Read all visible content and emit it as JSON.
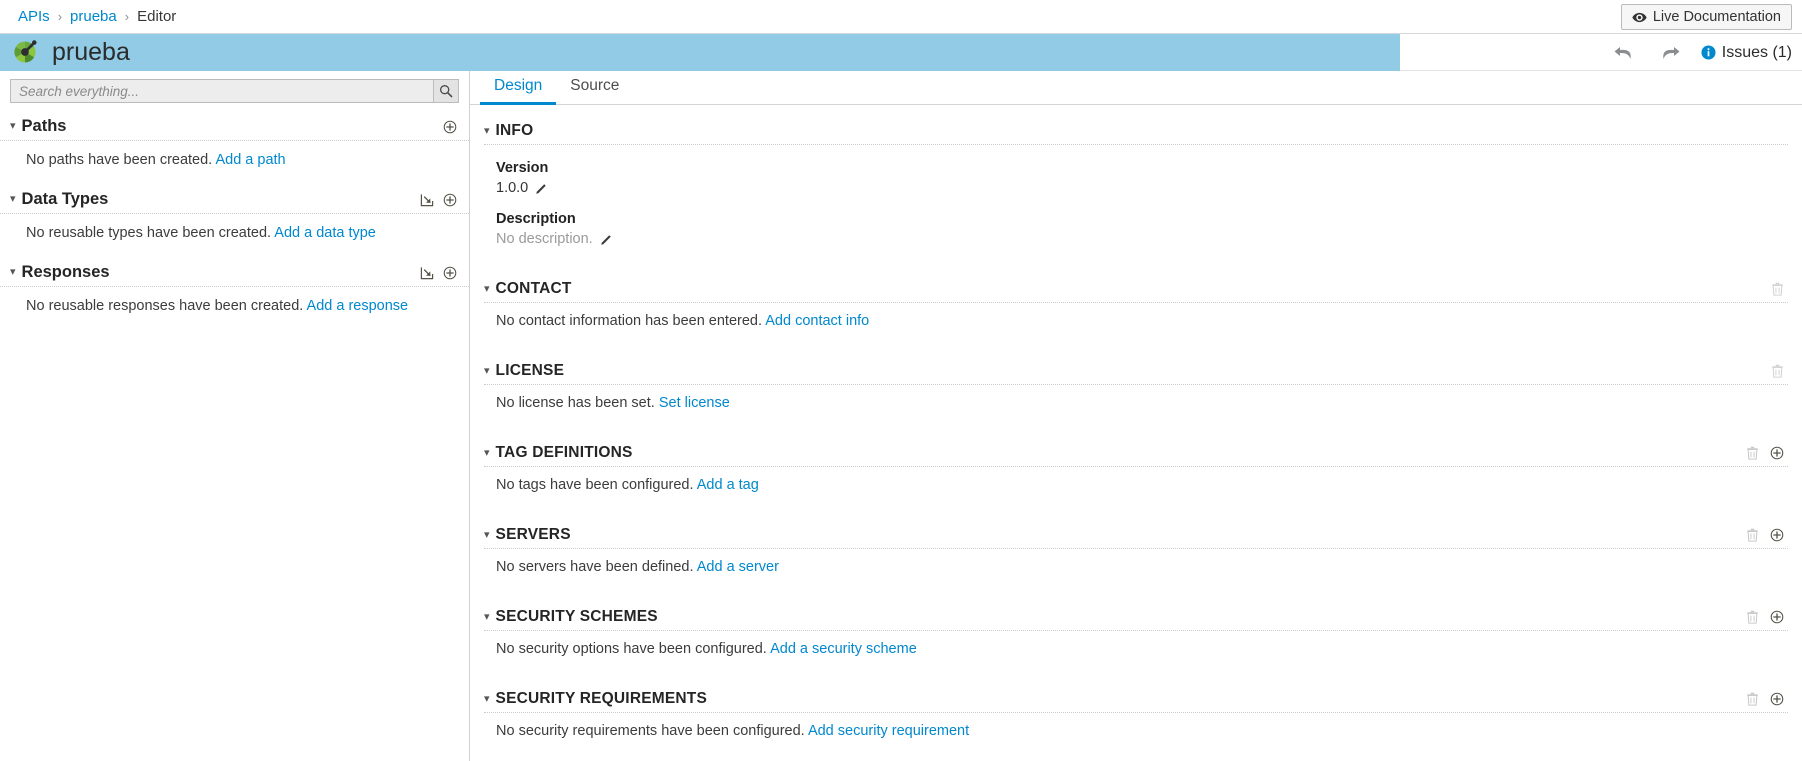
{
  "breadcrumb": {
    "items": [
      {
        "label": "APIs",
        "current": false
      },
      {
        "label": "prueba",
        "current": false
      },
      {
        "label": "Editor",
        "current": true
      }
    ],
    "separator": "›"
  },
  "topbar": {
    "live_documentation_label": "Live Documentation",
    "live_documentation_icon": "eye-icon"
  },
  "title_bar": {
    "api_name": "prueba",
    "logo_icon": "apicurio-logo-icon",
    "undo_icon": "undo-arrow-icon",
    "redo_icon": "redo-arrow-icon",
    "issues_label": "Issues (1)",
    "issues_icon": "info-circle-icon",
    "accent_color": "#91cbe5"
  },
  "sidebar": {
    "search": {
      "placeholder": "Search everything...",
      "value": "",
      "button_icon": "search-icon"
    },
    "sections": [
      {
        "title": "Paths",
        "caret_icon": "chevron-down-icon",
        "actions": [
          {
            "icon": "plus-circle-icon",
            "name": "add-path-icon"
          }
        ],
        "empty_text": "No paths have been created.",
        "empty_link": "Add a path"
      },
      {
        "title": "Data Types",
        "caret_icon": "chevron-down-icon",
        "actions": [
          {
            "icon": "import-icon",
            "name": "import-data-type-icon"
          },
          {
            "icon": "plus-circle-icon",
            "name": "add-data-type-icon"
          }
        ],
        "empty_text": "No reusable types have been created.",
        "empty_link": "Add a data type"
      },
      {
        "title": "Responses",
        "caret_icon": "chevron-down-icon",
        "actions": [
          {
            "icon": "import-icon",
            "name": "import-response-icon"
          },
          {
            "icon": "plus-circle-icon",
            "name": "add-response-icon"
          }
        ],
        "empty_text": "No reusable responses have been created.",
        "empty_link": "Add a response"
      }
    ]
  },
  "main": {
    "tabs": [
      {
        "label": "Design",
        "active": true
      },
      {
        "label": "Source",
        "active": false
      }
    ],
    "info": {
      "title": "INFO",
      "version_label": "Version",
      "version_value": "1.0.0",
      "description_label": "Description",
      "description_value": "No description.",
      "edit_icon": "pencil-icon"
    },
    "sections": [
      {
        "title": "CONTACT",
        "empty_text": "No contact information has been entered.",
        "empty_link": "Add contact info",
        "has_delete": true,
        "has_add": false
      },
      {
        "title": "LICENSE",
        "empty_text": "No license has been set.",
        "empty_link": "Set license",
        "has_delete": true,
        "has_add": false
      },
      {
        "title": "TAG DEFINITIONS",
        "empty_text": "No tags have been configured.",
        "empty_link": "Add a tag",
        "has_delete": true,
        "has_add": true
      },
      {
        "title": "SERVERS",
        "empty_text": "No servers have been defined.",
        "empty_link": "Add a server",
        "has_delete": true,
        "has_add": true
      },
      {
        "title": "SECURITY SCHEMES",
        "empty_text": "No security options have been configured.",
        "empty_link": "Add a security scheme",
        "has_delete": true,
        "has_add": true
      },
      {
        "title": "SECURITY REQUIREMENTS",
        "empty_text": "No security requirements have been configured.",
        "empty_link": "Add security requirement",
        "has_delete": true,
        "has_add": true
      }
    ]
  },
  "colors": {
    "link": "#0088ce",
    "header_blue": "#91cbe5",
    "text": "#333333",
    "muted": "#9b9b9b"
  }
}
